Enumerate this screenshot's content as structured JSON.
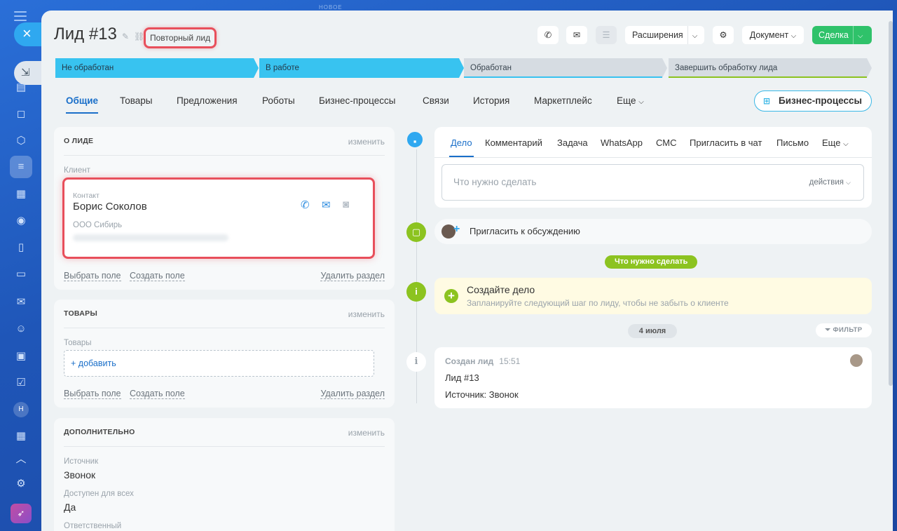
{
  "header": {
    "new_label": "НОВОЕ",
    "title": "Лид #13",
    "repeat_badge": "Повторный лид",
    "extensions_label": "Расширения",
    "document_label": "Документ",
    "deal_label": "Сделка"
  },
  "stages": [
    {
      "label": "Не обработан",
      "state": "done",
      "color": "#38c3f0"
    },
    {
      "label": "В работе",
      "state": "current",
      "color": "#38c3f0"
    },
    {
      "label": "Обработан",
      "state": "pending",
      "color": "#d6dce2"
    },
    {
      "label": "Завершить обработку лида",
      "state": "pending",
      "color": "#d6dce2"
    }
  ],
  "tabs": {
    "general": "Общие",
    "products": "Товары",
    "offers": "Предложения",
    "robots": "Роботы",
    "bizproc": "Бизнес-процессы",
    "links": "Связи",
    "history": "История",
    "marketplace": "Маркетплейс",
    "more": "Еще"
  },
  "bp_button": "Бизнес-процессы",
  "about": {
    "heading": "О ЛИДЕ",
    "edit": "изменить",
    "client_label": "Клиент",
    "contact_label": "Контакт",
    "contact_name": "Борис Соколов",
    "company": "ООО Сибирь",
    "select_field": "Выбрать поле",
    "create_field": "Создать поле",
    "delete_section": "Удалить раздел"
  },
  "products": {
    "heading": "ТОВАРЫ",
    "edit": "изменить",
    "label": "Товары",
    "add": "+ добавить",
    "select_field": "Выбрать поле",
    "create_field": "Создать поле",
    "delete_section": "Удалить раздел"
  },
  "extra": {
    "heading": "ДОПОЛНИТЕЛЬНО",
    "edit": "изменить",
    "source_label": "Источник",
    "source_value": "Звонок",
    "available_label": "Доступен для всех",
    "available_value": "Да",
    "responsible_label": "Ответственный"
  },
  "composer": {
    "tabs": {
      "task_case": "Дело",
      "comment": "Комментарий",
      "task": "Задача",
      "whatsapp": "WhatsApp",
      "sms": "СМС",
      "invite_chat": "Пригласить в чат",
      "letter": "Письмо",
      "more": "Еще"
    },
    "placeholder": "Что нужно сделать",
    "actions": "действия"
  },
  "timeline": {
    "invite": "Пригласить к обсуждению",
    "todo_pill": "Что нужно сделать",
    "create_title": "Создайте дело",
    "create_hint": "Запланируйте следующий шаг по лиду, чтобы не забыть о клиенте",
    "date": "4 июля",
    "filter": "ФИЛЬТР",
    "log_title": "Создан лид",
    "log_time": "15:51",
    "log_line1": "Лид #13",
    "log_line2": "Источник: Звонок"
  },
  "colors": {
    "accent": "#1a6fc9",
    "stage_active": "#38c3f0",
    "green": "#2fc26a",
    "highlight": "#e84f5b"
  }
}
